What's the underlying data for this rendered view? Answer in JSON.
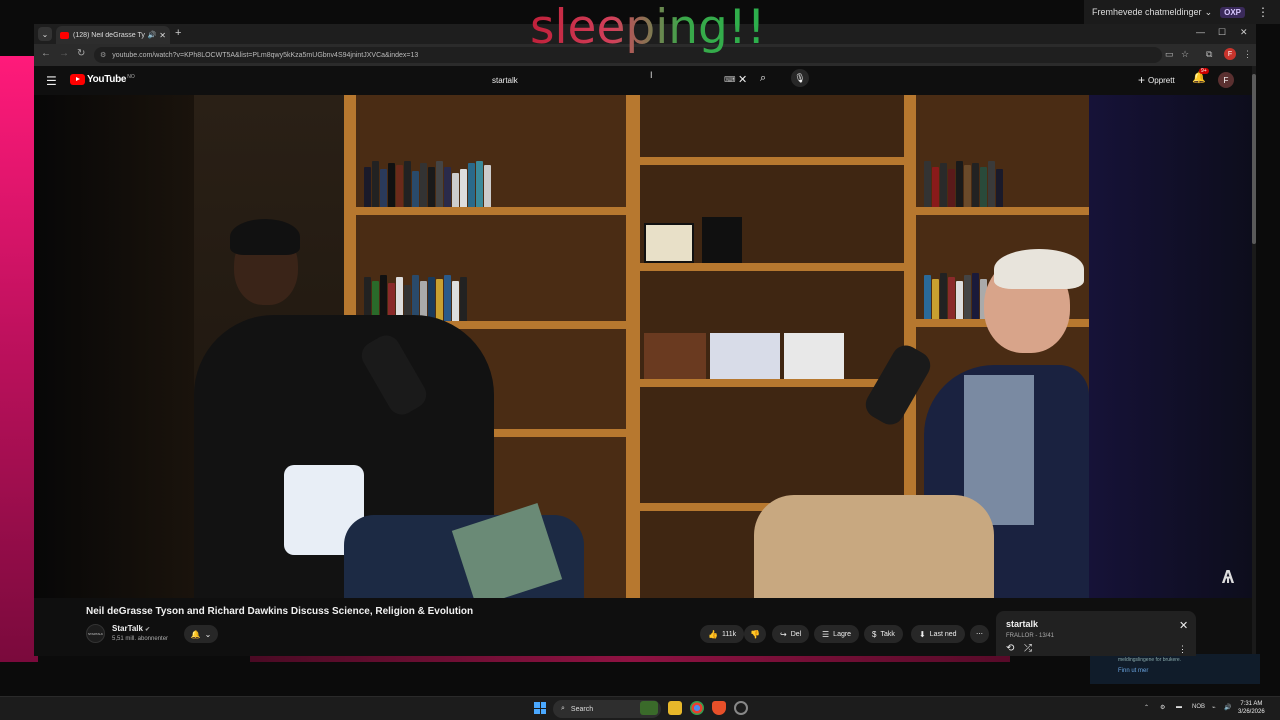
{
  "overlay": {
    "text": "sleeping!!"
  },
  "chat_dropdown": {
    "label": "Fremhevede chatmeldinger",
    "badge": "OXP"
  },
  "browser": {
    "tab_title": "(128) Neil deGrasse Tyson a",
    "url": "youtube.com/watch?v=KPh8LOCWT5A&list=PLm8qwy5kKza5mUGbnv4S94jnintJXVCa&index=13",
    "profile_initial": "F"
  },
  "youtube": {
    "logo_text": "YouTube",
    "logo_region": "NO",
    "search_query": "startalk",
    "create_label": "Opprett",
    "notification_badge": "9+",
    "avatar_initial": "F"
  },
  "video": {
    "title": "Neil deGrasse Tyson and Richard Dawkins Discuss Science, Religion & Evolution",
    "channel_name": "StarTalk",
    "channel_avatar_text": "STARTALK",
    "subscribers": "5,51 mill. abonnenter",
    "likes": "111k",
    "share_label": "Del",
    "save_label": "Lagre",
    "thanks_label": "Takk",
    "download_label": "Last ned"
  },
  "playlist": {
    "title": "startalk",
    "meta": "FRALLOR - 13/41"
  },
  "background_notification": {
    "text": "meldingslingene for brukere.",
    "link": "Finn ut mer"
  },
  "taskbar": {
    "search_placeholder": "Search",
    "language": "NOB",
    "time": "7:31 AM",
    "date": "3/26/2026"
  },
  "colors": {
    "youtube_red": "#ff0000",
    "background": "#0f0f0f",
    "pill": "#272727",
    "desktop_pink": "#ff1a7a"
  }
}
